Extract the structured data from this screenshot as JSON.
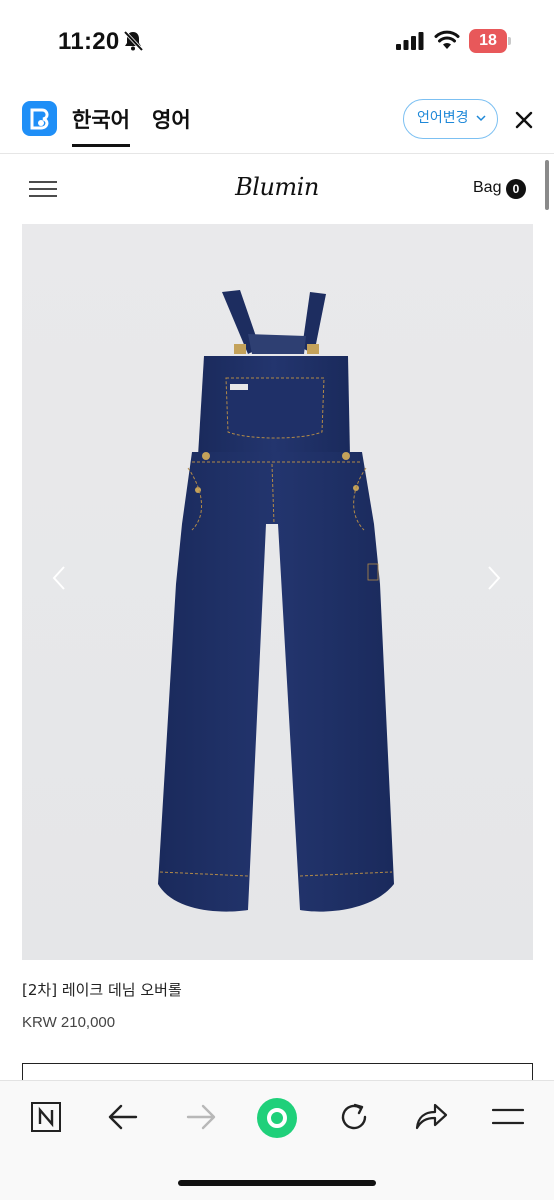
{
  "status_bar": {
    "time": "11:20",
    "battery": "18",
    "icons": [
      "bell-slash-icon",
      "cellular-signal-icon",
      "wifi-icon",
      "battery-icon"
    ]
  },
  "translate_bar": {
    "tabs": [
      {
        "label": "한국어",
        "active": true
      },
      {
        "label": "영어",
        "active": false
      }
    ],
    "change_language_label": "언어변경",
    "accent_color": "#1e88d8"
  },
  "site_header": {
    "brand": "Blumin",
    "bag_label": "Bag",
    "bag_count": "0"
  },
  "product": {
    "name": "[2차] 레이크 데님 오버롤",
    "price": "KRW 210,000",
    "image_alt": "navy denim overalls"
  },
  "browser_bar": {
    "buttons": [
      "naver-home-icon",
      "back-icon",
      "forward-icon",
      "green-dot-icon",
      "reload-icon",
      "share-icon",
      "menu-icon"
    ],
    "accent_color": "#1fd07a"
  }
}
